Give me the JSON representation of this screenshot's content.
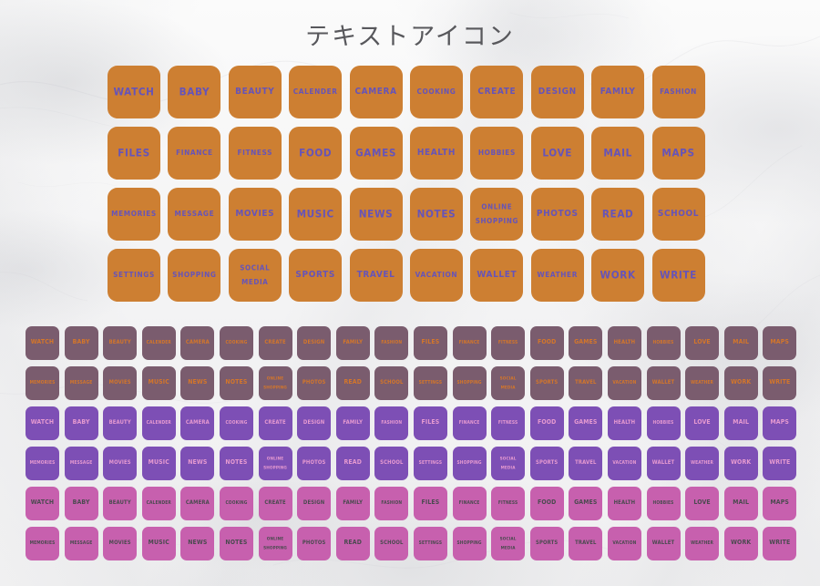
{
  "page": {
    "title": "テキストアイコン",
    "title_color": "#58585c",
    "background": "#f7f7f7",
    "background_style": "white-grey-marble-texture"
  },
  "icon_labels": [
    "WATCH",
    "BABY",
    "BEAUTY",
    "CALENDER",
    "CAMERA",
    "COOKING",
    "CREATE",
    "DESIGN",
    "FAMILY",
    "FASHION",
    "FILES",
    "FINANCE",
    "FITNESS",
    "FOOD",
    "GAMES",
    "HEALTH",
    "HOBBIES",
    "LOVE",
    "MAIL",
    "MAPS",
    "MEMORIES",
    "MESSAGE",
    "MOVIES",
    "MUSIC",
    "NEWS",
    "NOTES",
    "ONLINE SHOPPING",
    "PHOTOS",
    "READ",
    "SCHOOL",
    "SETTINGS",
    "SHOPPING",
    "SOCIAL MEDIA",
    "SPORTS",
    "TRAVEL",
    "VACATION",
    "WALLET",
    "WEATHER",
    "WORK",
    "WRITE"
  ],
  "main_grid": {
    "name": "large-orange-icon-grid",
    "columns": 10,
    "rows": 4,
    "tile_color": "#cd7f32",
    "text_color": "#6654b8",
    "tile_size_px": 58,
    "corner_radius_px": 11,
    "row_1": [
      "WATCH",
      "BABY",
      "BEAUTY",
      "CALENDER",
      "CAMERA",
      "COOKING",
      "CREATE",
      "DESIGN",
      "FAMILY",
      "FASHION"
    ],
    "row_2": [
      "FILES",
      "FINANCE",
      "FITNESS",
      "FOOD",
      "GAMES",
      "HEALTH",
      "HOBBIES",
      "LOVE",
      "MAIL",
      "MAPS"
    ],
    "row_3": [
      "MEMORIES",
      "MESSAGE",
      "MOVIES",
      "MUSIC",
      "NEWS",
      "NOTES",
      "ONLINE SHOPPING",
      "PHOTOS",
      "READ",
      "SCHOOL"
    ],
    "row_4": [
      "SETTINGS",
      "SHOPPING",
      "SOCIAL MEDIA",
      "SPORTS",
      "TRAVEL",
      "VACATION",
      "WALLET",
      "WEATHER",
      "WORK",
      "WRITE"
    ]
  },
  "variant_grids": [
    {
      "name": "small-mauve-icon-grid",
      "tile_color": "#7a5c6e",
      "text_color": "#d4762a",
      "columns": 20,
      "rows": 2,
      "tile_size_px": 37,
      "corner_radius_px": 7,
      "row_1": [
        "WATCH",
        "BABY",
        "BEAUTY",
        "CALENDER",
        "CAMERA",
        "COOKING",
        "CREATE",
        "DESIGN",
        "FAMILY",
        "FASHION",
        "FILES",
        "FINANCE",
        "FITNESS",
        "FOOD",
        "GAMES",
        "HEALTH",
        "HOBBIES",
        "LOVE",
        "MAIL",
        "MAPS"
      ],
      "row_2": [
        "MEMORIES",
        "MESSAGE",
        "MOVIES",
        "MUSIC",
        "NEWS",
        "NOTES",
        "ONLINE SHOPPING",
        "PHOTOS",
        "READ",
        "SCHOOL",
        "SETTINGS",
        "SHOPPING",
        "SOCIAL MEDIA",
        "SPORTS",
        "TRAVEL",
        "VACATION",
        "WALLET",
        "WEATHER",
        "WORK",
        "WRITE"
      ]
    },
    {
      "name": "small-purple-icon-grid",
      "tile_color": "#7d4fb5",
      "text_color": "#e69ad0",
      "columns": 20,
      "rows": 2,
      "tile_size_px": 37,
      "corner_radius_px": 7,
      "row_1": [
        "WATCH",
        "BABY",
        "BEAUTY",
        "CALENDER",
        "CAMERA",
        "COOKING",
        "CREATE",
        "DESIGN",
        "FAMILY",
        "FASHION",
        "FILES",
        "FINANCE",
        "FITNESS",
        "FOOD",
        "GAMES",
        "HEALTH",
        "HOBBIES",
        "LOVE",
        "MAIL",
        "MAPS"
      ],
      "row_2": [
        "MEMORIES",
        "MESSAGE",
        "MOVIES",
        "MUSIC",
        "NEWS",
        "NOTES",
        "ONLINE SHOPPING",
        "PHOTOS",
        "READ",
        "SCHOOL",
        "SETTINGS",
        "SHOPPING",
        "SOCIAL MEDIA",
        "SPORTS",
        "TRAVEL",
        "VACATION",
        "WALLET",
        "WEATHER",
        "WORK",
        "WRITE"
      ]
    },
    {
      "name": "small-pink-icon-grid",
      "tile_color": "#c760ae",
      "text_color": "#4a4a4f",
      "columns": 20,
      "rows": 2,
      "tile_size_px": 37,
      "corner_radius_px": 7,
      "row_1": [
        "WATCH",
        "BABY",
        "BEAUTY",
        "CALENDER",
        "CAMERA",
        "COOKING",
        "CREATE",
        "DESIGN",
        "FAMILY",
        "FASHION",
        "FILES",
        "FINANCE",
        "FITNESS",
        "FOOD",
        "GAMES",
        "HEALTH",
        "HOBBIES",
        "LOVE",
        "MAIL",
        "MAPS"
      ],
      "row_2": [
        "MEMORIES",
        "MESSAGE",
        "MOVIES",
        "MUSIC",
        "NEWS",
        "NOTES",
        "ONLINE SHOPPING",
        "PHOTOS",
        "READ",
        "SCHOOL",
        "SETTINGS",
        "SHOPPING",
        "SOCIAL MEDIA",
        "SPORTS",
        "TRAVEL",
        "VACATION",
        "WALLET",
        "WEATHER",
        "WORK",
        "WRITE"
      ]
    }
  ]
}
